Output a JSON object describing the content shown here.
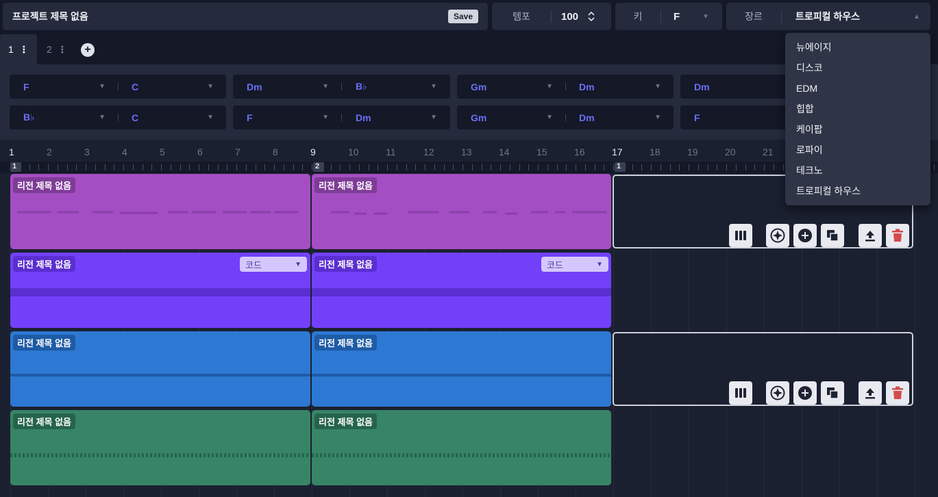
{
  "project": {
    "title": "프로젝트 제목 없음",
    "save_label": "Save"
  },
  "tempo": {
    "label": "템포",
    "value": "100"
  },
  "key": {
    "label": "키",
    "value": "F"
  },
  "genre": {
    "label": "장르",
    "value": "트로피컬 하우스",
    "options": [
      "뉴에이지",
      "디스코",
      "EDM",
      "힙합",
      "케이팝",
      "로파이",
      "테크노",
      "트로피컬 하우스"
    ]
  },
  "tabs": [
    {
      "label": "1"
    },
    {
      "label": "2"
    }
  ],
  "chords": {
    "row1": [
      "F",
      "C",
      "Dm",
      "B♭",
      "Gm",
      "Dm",
      "Dm"
    ],
    "row2": [
      "B♭",
      "C",
      "F",
      "Dm",
      "Gm",
      "Dm",
      "F"
    ]
  },
  "ruler": {
    "bars": [
      "1",
      "2",
      "3",
      "4",
      "5",
      "6",
      "7",
      "8",
      "9",
      "10",
      "11",
      "12",
      "13",
      "14",
      "15",
      "16",
      "17",
      "18",
      "19",
      "20",
      "21"
    ]
  },
  "sections": {
    "marker_1": "1",
    "marker_2": "2",
    "marker_3": "1"
  },
  "regions": {
    "title": "리전 제목 없음",
    "code_select": "코드"
  },
  "colors": {
    "track1": "#a44ec3",
    "track2": "#7340fa",
    "track3": "#2d78d2",
    "track4": "#378466"
  },
  "icons": {
    "piano": "piano-roll-icon",
    "ai": "sparkle-icon",
    "add": "plus-circle-icon",
    "copy": "copy-icon",
    "upload": "upload-icon",
    "delete": "trash-icon"
  }
}
